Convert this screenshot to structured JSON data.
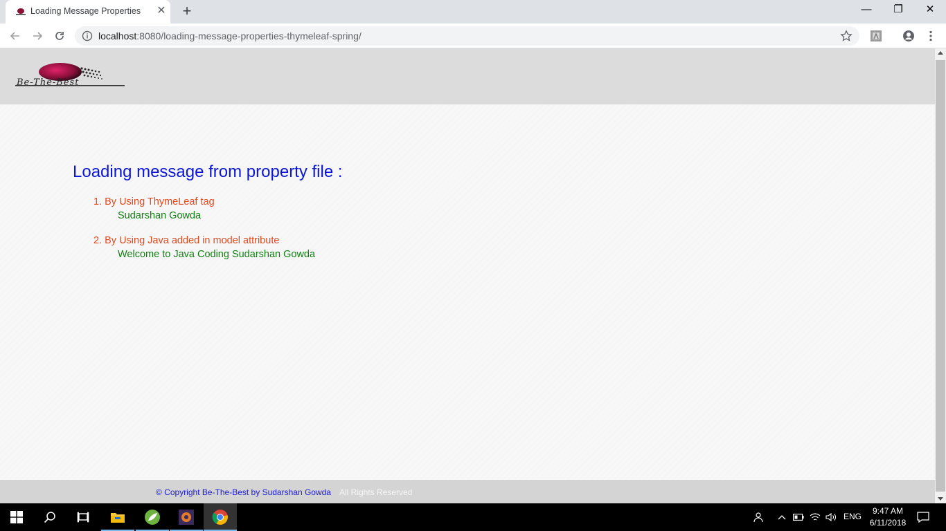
{
  "browser": {
    "tab_title": "Loading Message Properties",
    "tab_close": "✕",
    "new_tab": "+",
    "url_host": "localhost",
    "url_path": ":8080/loading-message-properties-thymeleaf-spring/",
    "window_controls": {
      "minimize": "—",
      "restore": "❐",
      "close": "✕"
    }
  },
  "site": {
    "logo_text": "Be-The-Best"
  },
  "content": {
    "heading": "Loading message from property file :",
    "items": [
      {
        "label": "1. By Using ThymeLeaf tag",
        "value": "Sudarshan Gowda"
      },
      {
        "label": "2. By Using Java added in model attribute",
        "value": "Welcome to Java Coding Sudarshan Gowda"
      }
    ]
  },
  "footer": {
    "copyright": "© Copyright Be-The-Best by Sudarshan Gowda",
    "rights": "All Rights Reserved"
  },
  "taskbar": {
    "language": "ENG",
    "time": "9:47 AM",
    "date": "6/11/2018"
  },
  "colors": {
    "heading": "#0b16d6",
    "item_label": "#e4491c",
    "item_value": "#0f7f10",
    "copyright": "#1b1bd6"
  },
  "icons": [
    "favicon-icon",
    "back-arrow-icon",
    "forward-arrow-icon",
    "reload-icon",
    "info-icon",
    "star-icon",
    "extension-icon",
    "account-icon",
    "menu-dots-icon",
    "windows-start-icon",
    "search-icon",
    "task-view-icon",
    "file-explorer-icon",
    "spring-tool-icon",
    "app-icon",
    "chrome-icon",
    "people-icon",
    "chevron-up-icon",
    "battery-icon",
    "wifi-icon",
    "volume-icon",
    "notification-icon"
  ]
}
